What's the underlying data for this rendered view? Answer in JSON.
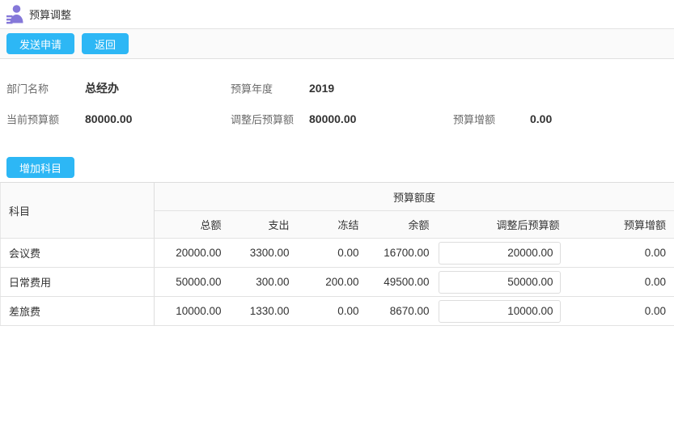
{
  "header": {
    "title": "预算调整",
    "icon": "user-report-icon"
  },
  "toolbar": {
    "send_label": "发送申请",
    "back_label": "返回"
  },
  "summary": {
    "department": {
      "label": "部门名称",
      "value": "总经办"
    },
    "year": {
      "label": "预算年度",
      "value": "2019"
    },
    "current_budget": {
      "label": "当前预算额",
      "value": "80000.00"
    },
    "adjusted_budget": {
      "label": "调整后预算额",
      "value": "80000.00"
    },
    "budget_increase": {
      "label": "预算增额",
      "value": "0.00"
    }
  },
  "add_subject": {
    "label": "增加科目"
  },
  "table": {
    "subject_header": "科目",
    "group_header": "预算额度",
    "columns": {
      "total": "总额",
      "spent": "支出",
      "frozen": "冻结",
      "balance": "余额",
      "adjusted": "调整后预算额",
      "increase": "预算增额"
    },
    "rows": [
      {
        "subject": "会议费",
        "total": "20000.00",
        "spent": "3300.00",
        "frozen": "0.00",
        "balance": "16700.00",
        "adjusted": "20000.00",
        "increase": "0.00"
      },
      {
        "subject": "日常费用",
        "total": "50000.00",
        "spent": "300.00",
        "frozen": "200.00",
        "balance": "49500.00",
        "adjusted": "50000.00",
        "increase": "0.00"
      },
      {
        "subject": "差旅费",
        "total": "10000.00",
        "spent": "1330.00",
        "frozen": "0.00",
        "balance": "8670.00",
        "adjusted": "10000.00",
        "increase": "0.00"
      }
    ]
  },
  "colors": {
    "accent_blue": "#2db7f5",
    "icon_purple": "#8578d9",
    "header_bg": "#fafafa",
    "border": "#dddddd",
    "label_gray": "#6b6b6b",
    "text_dark": "#333333"
  }
}
